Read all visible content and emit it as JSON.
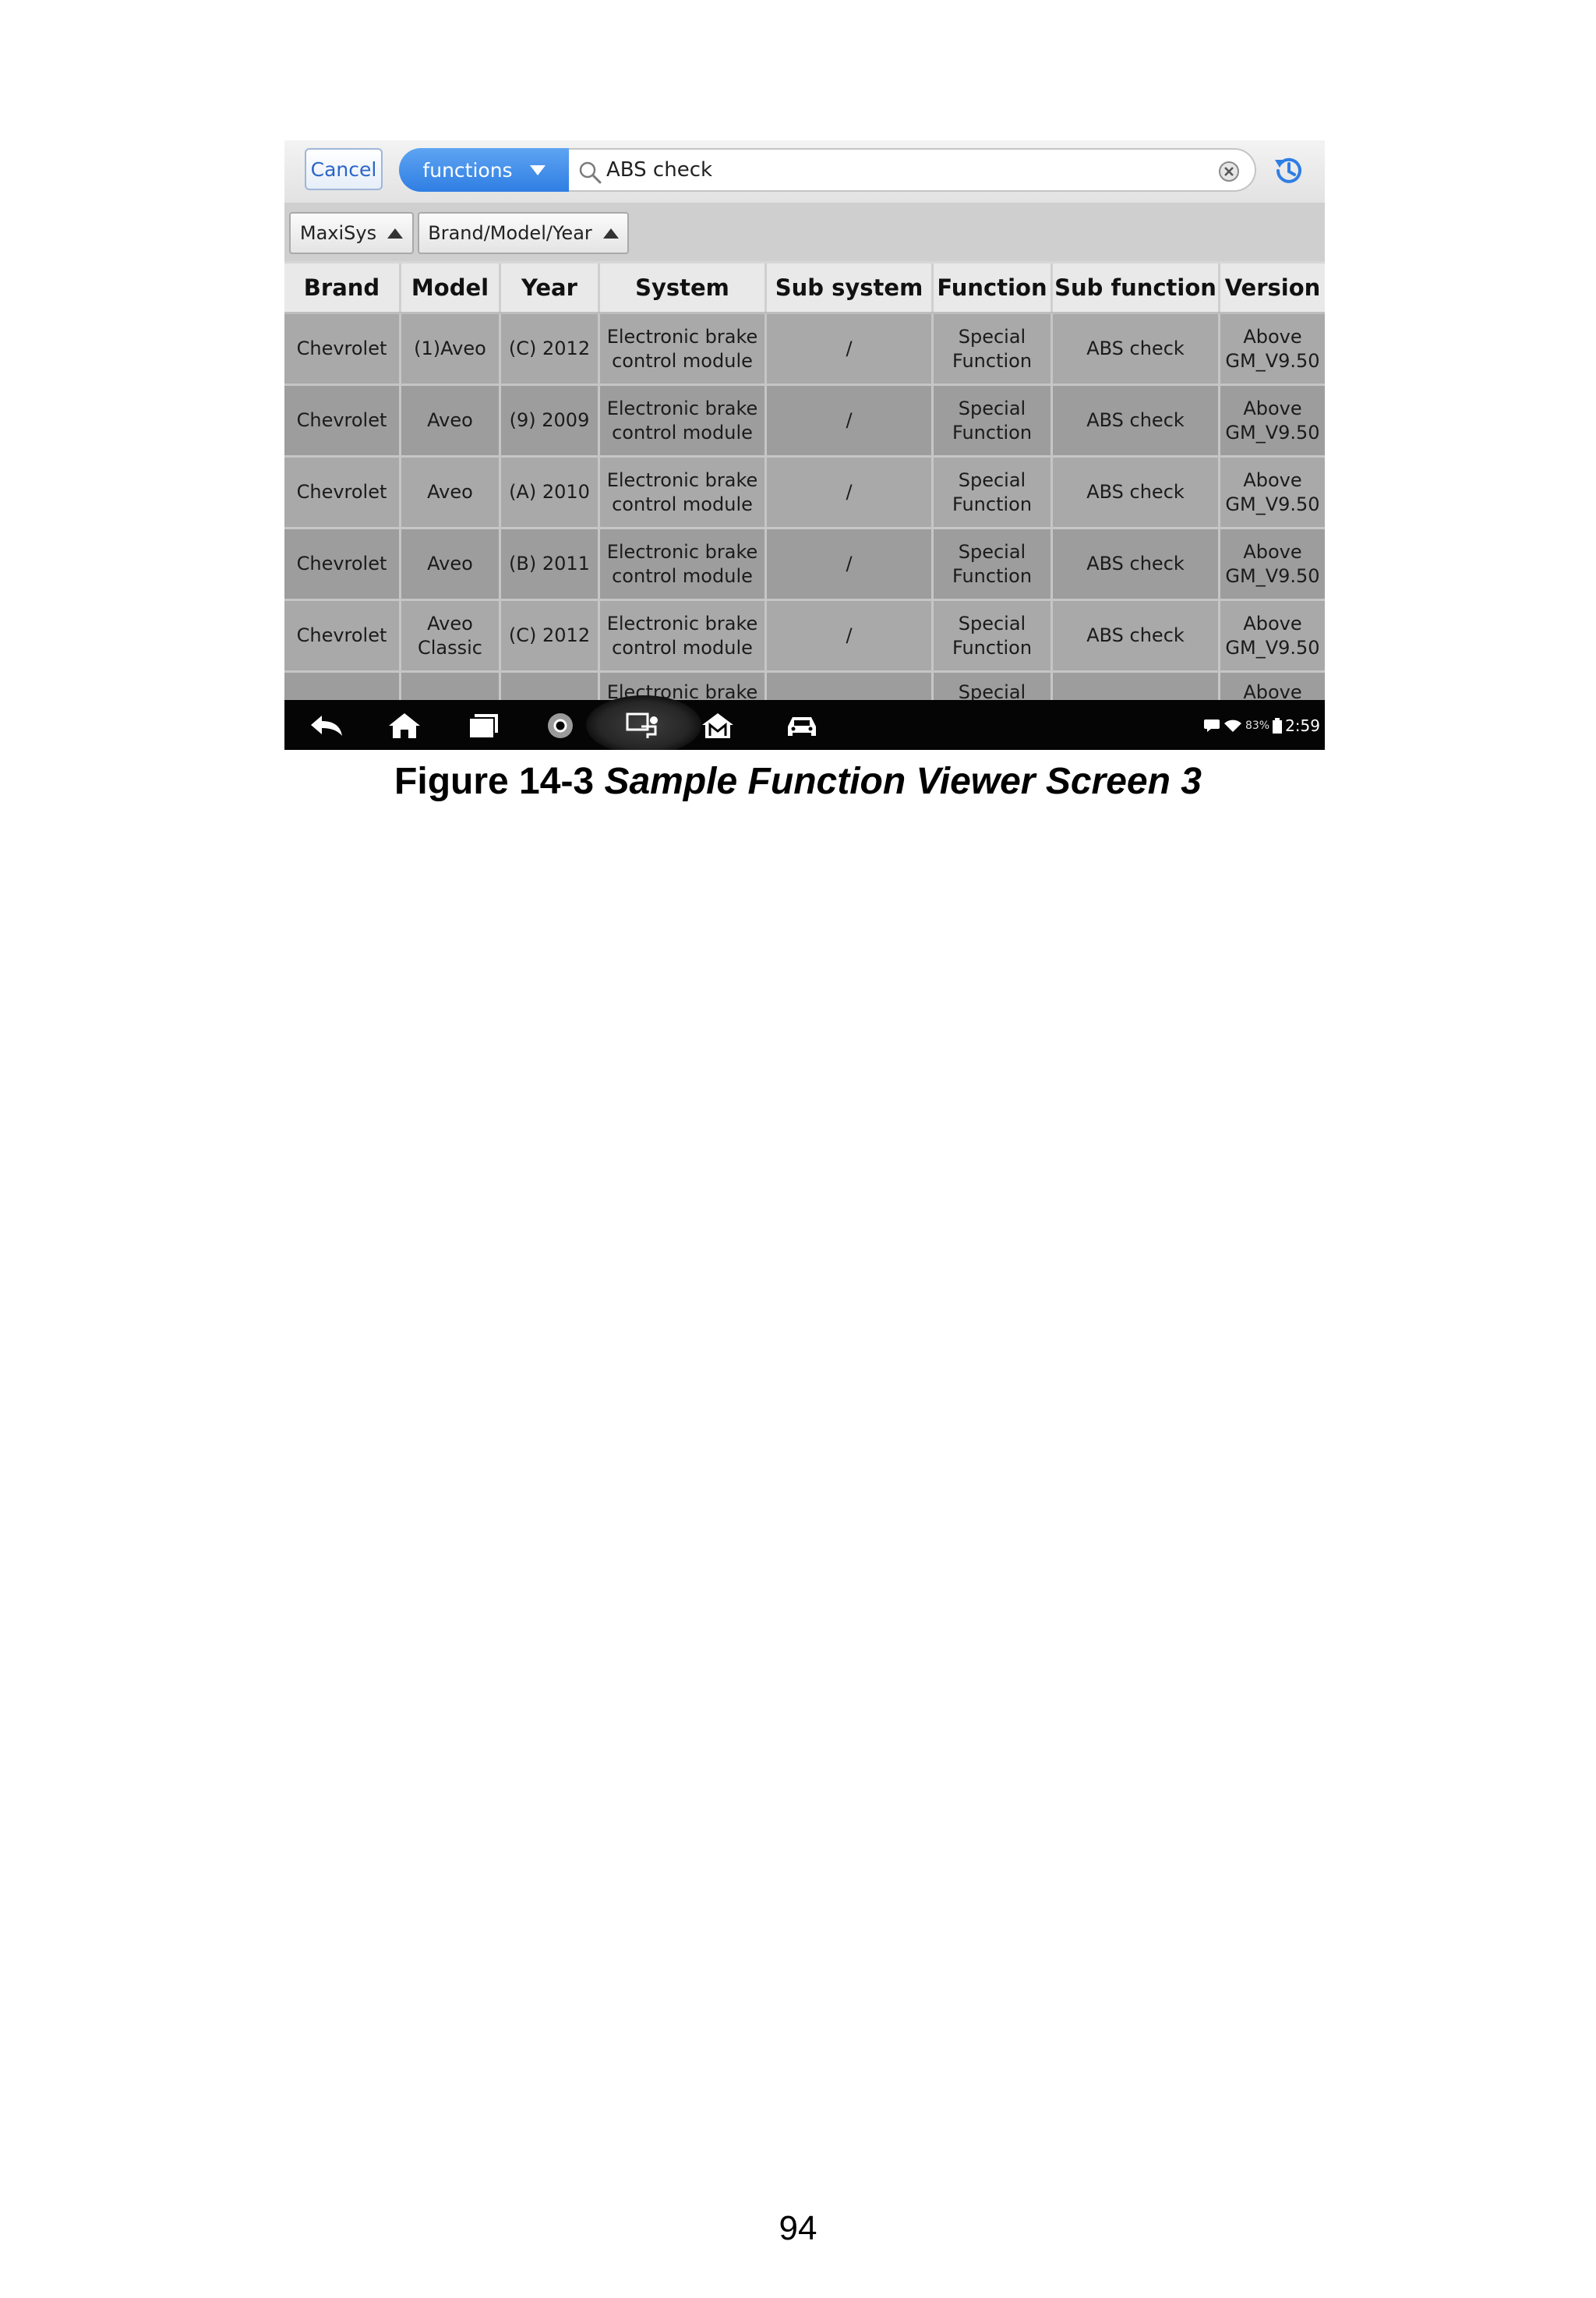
{
  "search_bar": {
    "cancel_label": "Cancel",
    "category_selected": "functions",
    "query": "ABS check"
  },
  "filters": [
    {
      "label": "MaxiSys"
    },
    {
      "label": "Brand/Model/Year"
    }
  ],
  "table": {
    "columns": [
      "Brand",
      "Model",
      "Year",
      "System",
      "Sub system",
      "Function",
      "Sub function",
      "Version"
    ],
    "rows": [
      [
        "Chevrolet",
        "(1)Aveo",
        "(C) 2012",
        "Electronic brake\ncontrol module",
        "/",
        "Special\nFunction",
        "ABS check",
        "Above\nGM_V9.50"
      ],
      [
        "Chevrolet",
        "Aveo",
        "(9) 2009",
        "Electronic brake\ncontrol module",
        "/",
        "Special\nFunction",
        "ABS check",
        "Above\nGM_V9.50"
      ],
      [
        "Chevrolet",
        "Aveo",
        "(A) 2010",
        "Electronic brake\ncontrol module",
        "/",
        "Special\nFunction",
        "ABS check",
        "Above\nGM_V9.50"
      ],
      [
        "Chevrolet",
        "Aveo",
        "(B) 2011",
        "Electronic brake\ncontrol module",
        "/",
        "Special\nFunction",
        "ABS check",
        "Above\nGM_V9.50"
      ],
      [
        "Chevrolet",
        "Aveo\nClassic",
        "(C) 2012",
        "Electronic brake\ncontrol module",
        "/",
        "Special\nFunction",
        "ABS check",
        "Above\nGM_V9.50"
      ],
      [
        "",
        "",
        "",
        "Electronic brake",
        "",
        "Special",
        "",
        "Above"
      ]
    ]
  },
  "navbar": {
    "icons": [
      "back-icon",
      "home-icon",
      "recent-apps-icon",
      "browser-icon",
      "remote-desk-icon",
      "maxisys-home-icon",
      "car-icon"
    ],
    "battery": "83%",
    "time": "2:59"
  },
  "caption": {
    "prefix": "Figure 14-3 ",
    "title": "Sample Function Viewer Screen 3"
  },
  "page_number": "94"
}
